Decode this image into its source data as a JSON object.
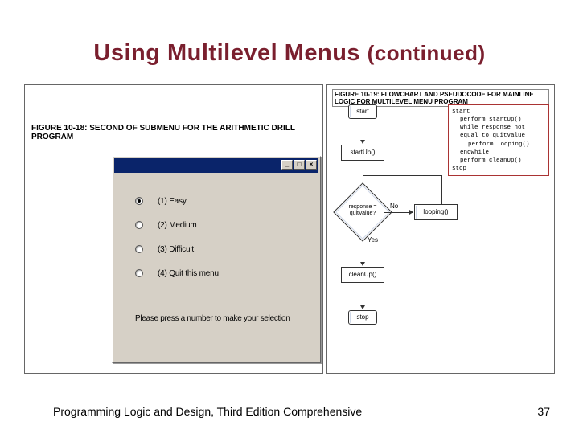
{
  "title_main": "Using Multilevel Menus ",
  "title_cont": "(continued)",
  "left_figure_caption": "FIGURE 10-18: SECOND OF SUBMENU FOR THE ARITHMETIC DRILL PROGRAM",
  "options": [
    {
      "label": "(1) Easy",
      "selected": true
    },
    {
      "label": "(2) Medium",
      "selected": false
    },
    {
      "label": "(3) Difficult",
      "selected": false
    },
    {
      "label": "(4) Quit this menu",
      "selected": false
    }
  ],
  "prompt_text": "Please press a number to make your selection",
  "right_figure_caption": "FIGURE 10-19: FLOWCHART AND PSEUDOCODE FOR MAINLINE LOGIC FOR MULTILEVEL MENU PROGRAM",
  "flow": {
    "start": "start",
    "startup": "startUp()",
    "decision": "response = quitValue?",
    "branch_no": "No",
    "branch_yes": "Yes",
    "looping": "looping()",
    "cleanup": "cleanUp()",
    "stop": "stop"
  },
  "pseudo": {
    "l0": "start",
    "l1": "perform startUp()",
    "l2": "while response not equal to quitValue",
    "l3": "perform looping()",
    "l4": "endwhile",
    "l5": "perform cleanUp()",
    "l6": "stop"
  },
  "footer_text": "Programming Logic and Design, Third Edition Comprehensive",
  "page_number": "37"
}
